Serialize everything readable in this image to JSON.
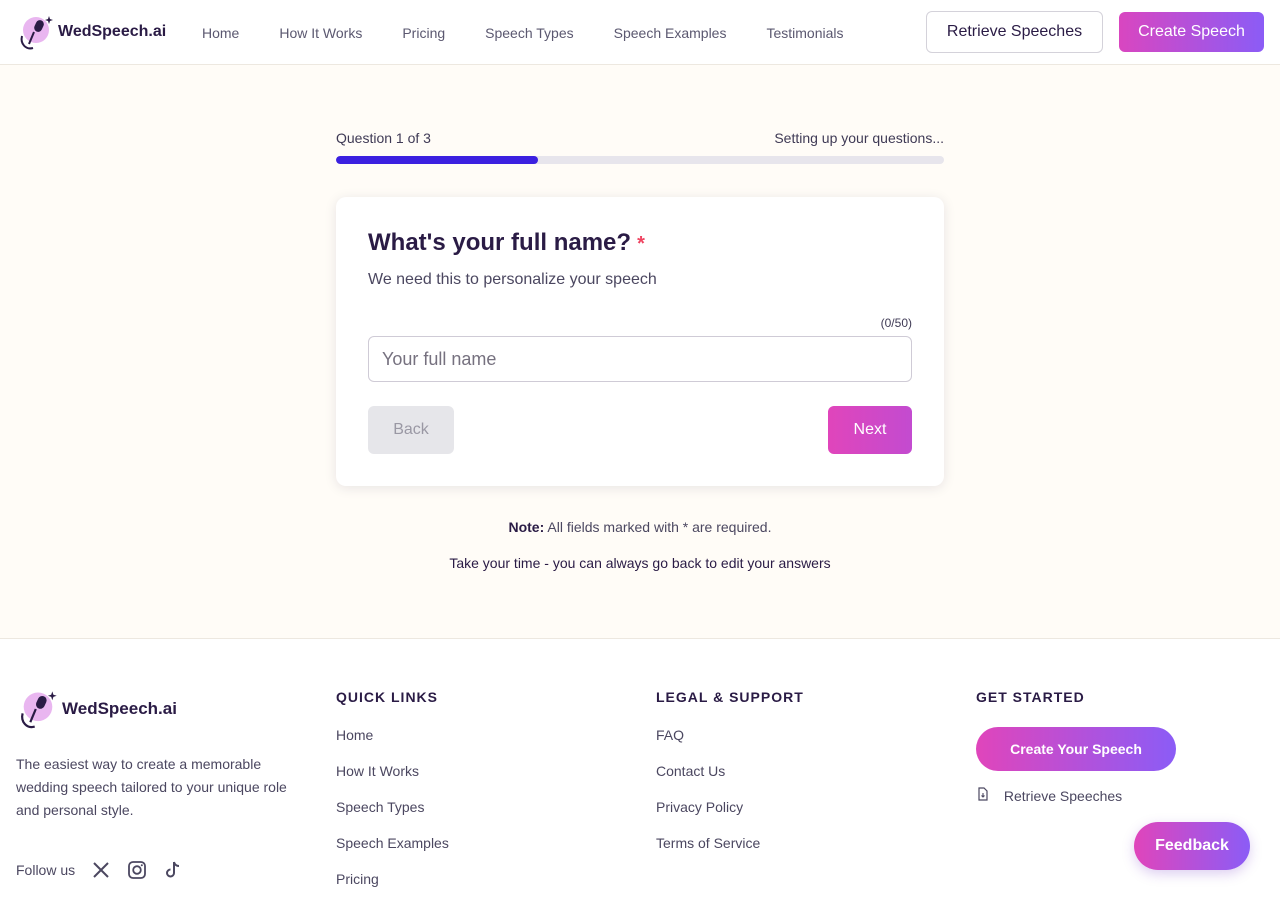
{
  "brand": {
    "name": "WedSpeech.ai"
  },
  "nav": {
    "items": [
      {
        "label": "Home"
      },
      {
        "label": "How It Works"
      },
      {
        "label": "Pricing"
      },
      {
        "label": "Speech Types"
      },
      {
        "label": "Speech Examples"
      },
      {
        "label": "Testimonials"
      }
    ],
    "retrieve_label": "Retrieve Speeches",
    "create_label": "Create Speech"
  },
  "progress": {
    "step_label": "Question 1 of 3",
    "status": "Setting up your questions...",
    "fraction": 0.333
  },
  "question": {
    "title": "What's your full name?",
    "required_marker": "*",
    "subtitle": "We need this to personalize your speech",
    "char_count": "(0/50)",
    "input_value": "",
    "input_placeholder": "Your full name",
    "back_label": "Back",
    "next_label": "Next"
  },
  "note": {
    "prefix": "Note:",
    "text": "All fields marked with * are required."
  },
  "tip": "Take your time - you can always go back to edit your answers",
  "footer": {
    "description": "The easiest way to create a memorable wedding speech tailored to your unique role and personal style.",
    "follow_label": "Follow us",
    "social_icons": [
      "x-icon",
      "instagram-icon",
      "tiktok-icon"
    ],
    "quick_links": {
      "heading": "QUICK LINKS",
      "items": [
        "Home",
        "How It Works",
        "Speech Types",
        "Speech Examples",
        "Pricing"
      ]
    },
    "legal": {
      "heading": "LEGAL & SUPPORT",
      "items": [
        "FAQ",
        "Contact Us",
        "Privacy Policy",
        "Terms of Service"
      ]
    },
    "get_started": {
      "heading": "GET STARTED",
      "cta_label": "Create Your Speech",
      "retrieve_label": "Retrieve Speeches"
    }
  },
  "feedback_label": "Feedback",
  "colors": {
    "accent_pink": "#e045bb",
    "accent_purple": "#8b5cf6",
    "progress": "#3b20e0",
    "required": "#ef4461",
    "background": "#fffcf7"
  }
}
